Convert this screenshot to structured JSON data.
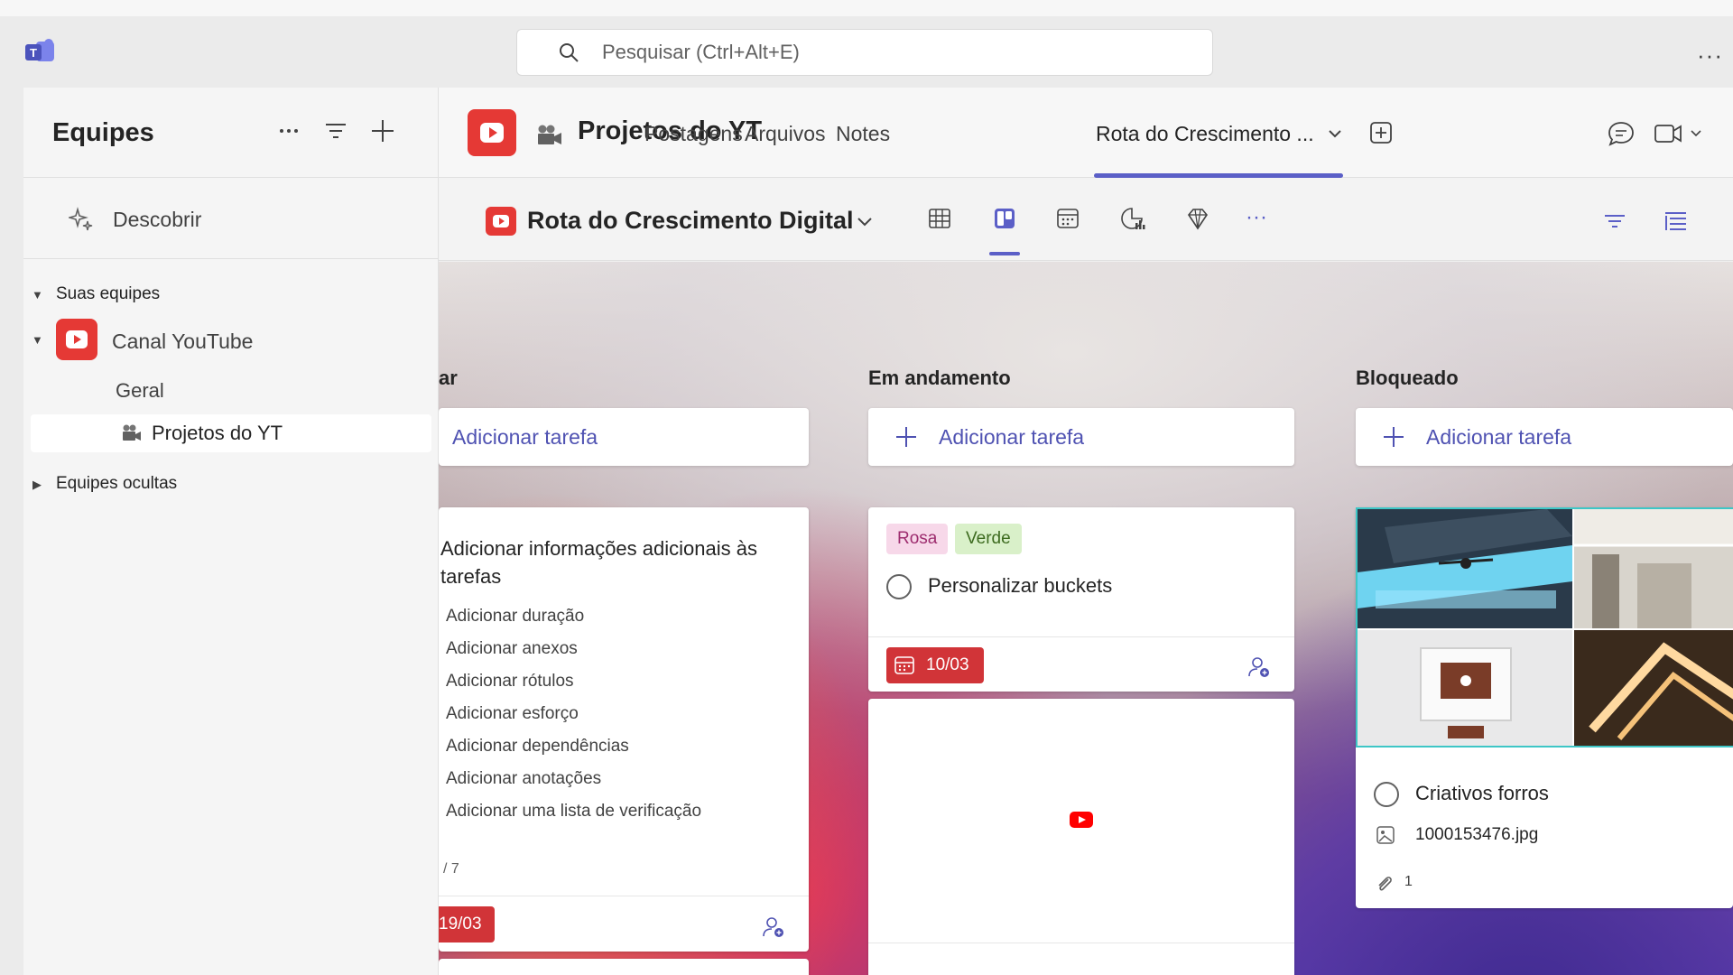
{
  "search": {
    "placeholder": "Pesquisar (Ctrl+Alt+E)"
  },
  "sidebar": {
    "title": "Equipes",
    "discover": "Descobrir",
    "your_teams": "Suas equipes",
    "team": "Canal YouTube",
    "channels": [
      "Geral",
      "Projetos do YT"
    ],
    "hidden_teams": "Equipes ocultas"
  },
  "channel": {
    "name": "Projetos do YT",
    "tabs": [
      "Postagens",
      "Arquivos",
      "Notes",
      "Rota do Crescimento ..."
    ],
    "active_tab": "Rota do Crescimento ..."
  },
  "plan": {
    "title": "Rota do Crescimento Digital"
  },
  "board": {
    "add_task_label": "Adicionar tarefa",
    "columns": [
      {
        "title": "ar",
        "cards": [
          {
            "title": "Adicionar informações adicionais às tarefas",
            "checklist": [
              "Adicionar duração",
              "Adicionar anexos",
              "Adicionar rótulos",
              "Adicionar esforço",
              "Adicionar dependências",
              "Adicionar anotações",
              "Adicionar uma lista de verificação"
            ],
            "progress": "/ 7",
            "due": "19/03"
          }
        ]
      },
      {
        "title": "Em andamento",
        "cards": [
          {
            "labels": [
              "Rosa",
              "Verde"
            ],
            "title": "Personalizar buckets",
            "due": "10/03"
          },
          {
            "title": ""
          }
        ]
      },
      {
        "title": "Bloqueado",
        "cards": [
          {
            "title": "Criativos forros",
            "attachment": "1000153476.jpg",
            "attachment_count": "1"
          }
        ]
      }
    ]
  },
  "colors": {
    "accent": "#5b5fc7",
    "youtube": "#e53935",
    "due_red": "#d13438"
  }
}
